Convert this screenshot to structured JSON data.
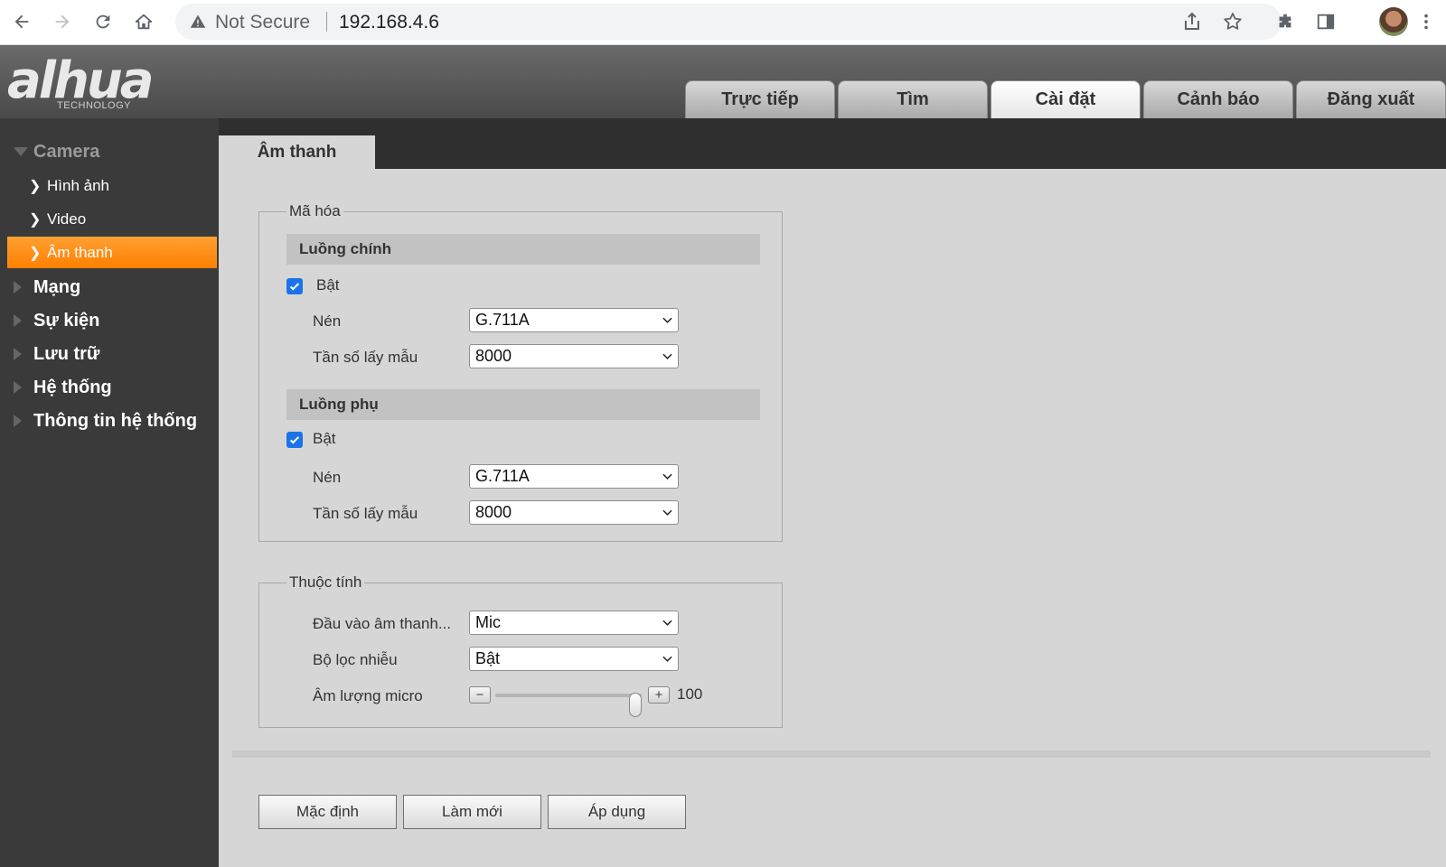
{
  "browser": {
    "not_secure": "Not Secure",
    "url": "192.168.4.6"
  },
  "logo": {
    "main": "alhua",
    "sub": "TECHNOLOGY"
  },
  "tabs": [
    {
      "label": "Trực tiếp",
      "active": false
    },
    {
      "label": "Tìm",
      "active": false
    },
    {
      "label": "Cài đặt",
      "active": true
    },
    {
      "label": "Cảnh báo",
      "active": false
    },
    {
      "label": "Đăng xuất",
      "active": false
    }
  ],
  "sidebar": {
    "camera": "Camera",
    "items": [
      "Hình ảnh",
      "Video",
      "Âm thanh"
    ],
    "categories": [
      "Mạng",
      "Sự kiện",
      "Lưu trữ",
      "Hệ thống",
      "Thông tin hệ thống"
    ]
  },
  "page": {
    "tab": "Âm thanh"
  },
  "encoding": {
    "legend": "Mã hóa",
    "main_stream": {
      "header": "Luồng chính",
      "enable_label": "Bật",
      "enabled": true,
      "compression_label": "Nén",
      "compression": "G.711A",
      "sampling_label": "Tần số lấy mẫu",
      "sampling": "8000"
    },
    "sub_stream": {
      "header": "Luồng phụ",
      "enable_label": "Bật",
      "enabled": true,
      "compression_label": "Nén",
      "compression": "G.711A",
      "sampling_label": "Tần số lấy mẫu",
      "sampling": "8000"
    }
  },
  "attributes": {
    "legend": "Thuộc tính",
    "audio_in_label": "Đầu vào âm thanh...",
    "audio_in": "Mic",
    "noise_filter_label": "Bộ lọc nhiễu",
    "noise_filter": "Bật",
    "mic_volume_label": "Âm lượng micro",
    "mic_volume": "100",
    "mic_volume_fraction": 1.0
  },
  "buttons": {
    "default": "Mặc định",
    "refresh": "Làm mới",
    "apply": "Áp dụng"
  },
  "colors": {
    "accent": "#ff8c1a",
    "checkbox": "#1a73e8"
  }
}
